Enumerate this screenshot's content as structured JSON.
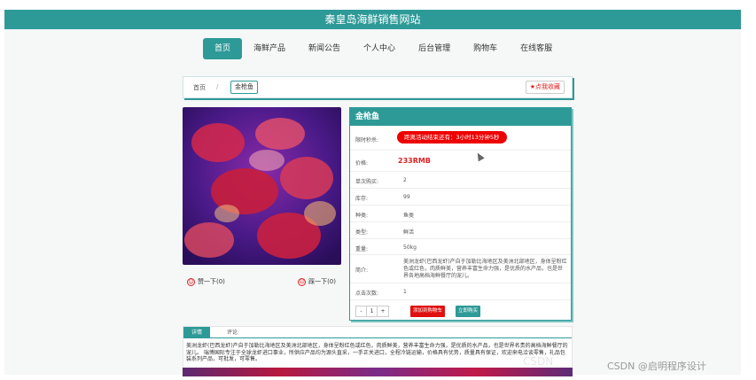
{
  "site_title": "秦皇岛海鲜销售网站",
  "nav": {
    "items": [
      "首页",
      "海鲜产品",
      "新闻公告",
      "个人中心",
      "后台管理",
      "购物车",
      "在线客服"
    ],
    "active_index": 0
  },
  "breadcrumb": {
    "home": "首页",
    "separator": "/",
    "current": "金枪鱼"
  },
  "favorite_label": "点我收藏",
  "product": {
    "name": "金枪鱼",
    "like_label": "赞一下(0)",
    "dislike_label": "踩一下(0)",
    "fields": {
      "countdown": {
        "label": "限时秒杀:",
        "value": "距离活动结束还有：3小时13分钟5秒"
      },
      "price": {
        "label": "价格:",
        "value": "233RMB"
      },
      "single_limit": {
        "label": "单次购买:",
        "value": "2"
      },
      "stock": {
        "label": "库存:",
        "value": "99"
      },
      "category": {
        "label": "种类:",
        "value": "鱼类"
      },
      "type": {
        "label": "类型:",
        "value": "鲜活"
      },
      "weight": {
        "label": "重量:",
        "value": "50kg"
      },
      "intro": {
        "label": "简介:",
        "value": "美洲龙虾(巴西龙虾)产自于加勒比海地区及美洲北部地区，身体呈粉红色或红色，肉质鲜美，营养丰富生命力强，是优质的水产品，也是世界各地高档海鲜餐厅的宠儿。"
      },
      "clicks": {
        "label": "点击次数:",
        "value": "1"
      }
    },
    "quantity": {
      "minus": "-",
      "value": "1",
      "plus": "+"
    },
    "add_to_cart_label": "添加到购物车",
    "buy_now_label": "立即购买"
  },
  "tabs": {
    "items": [
      "详情",
      "评论"
    ],
    "active_index": 0,
    "description": "美洲龙虾(巴西龙虾)产自于加勒比海地区及美洲北部地区，身体呈粉红色或红色，肉质鲜美，营养丰富生命力强，是优质的水产品，也是世界名贵的高档海鲜餐厅的宠儿。 瑞博国际专注于全球龙虾进口事业，所供应产品均为源头直采，一手正关进口，全程冷链运输，价格具有优势，质量具有保证，欢迎来电洽谈零售，礼品包装系列产品，可批发，可零售。"
  },
  "watermark": "CSDN @启明程序设计",
  "watermark_ghost": "CSDN",
  "colors": {
    "accent": "#2e9a98",
    "alert": "#e01010"
  }
}
